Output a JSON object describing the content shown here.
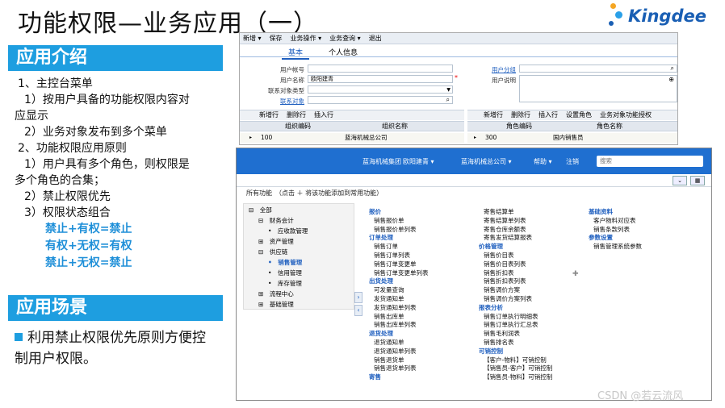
{
  "title": "功能权限—业务应用（一）",
  "logo_text": "Kingdee",
  "section1": "应用介绍",
  "section2": "应用场景",
  "left_lines": [
    "1、主控台菜单",
    "1）按用户具备的功能权限内容对",
    "应显示",
    "2）业务对象发布到多个菜单",
    "2、功能权限应用原则",
    "1）用户具有多个角色，则权限是",
    "多个角色的合集；",
    "2）禁止权限优先",
    "3）权限状态组合"
  ],
  "highlight_lines": [
    "禁止+有权=禁止",
    "有权+无权=有权",
    "禁止+无权=禁止"
  ],
  "bullet_text": "利用禁止权限优先原则方便控制用户权限。",
  "watermark": "CSDN @若云流风",
  "win1": {
    "toolbar": [
      "新增 ▾",
      "保存",
      "业务操作 ▾",
      "业务查询 ▾",
      "退出"
    ],
    "tabs": [
      "基本",
      "个人信息"
    ],
    "fields": {
      "account_label": "用户帐号",
      "name_label": "用户名称",
      "name_value": "欧阳建青",
      "objtype_label": "联系对象类型",
      "obj_label": "联系对象",
      "group_label": "用户分组",
      "desc_label": "用户说明"
    },
    "grid_left": {
      "actions": [
        "新增行",
        "删除行",
        "插入行"
      ],
      "headers": [
        "组织编码",
        "组织名称"
      ],
      "row": [
        "100",
        "蓝海机械总公司"
      ]
    },
    "grid_right": {
      "actions": [
        "新增行",
        "删除行",
        "插入行",
        "设置角色",
        "业务对象功能授权"
      ],
      "headers": [
        "角色编码",
        "角色名称"
      ],
      "row": [
        "300",
        "国内销售员"
      ]
    }
  },
  "win2": {
    "nav": [
      "蓝海机械集团",
      "欧阳建青 ▾",
      "蓝海机械总公司 ▾",
      "帮助 ▾",
      "注销"
    ],
    "search_placeholder": "搜索",
    "crumb": "所有功能　（点击 ＋ 将该功能添加到常用功能）",
    "tree": [
      {
        "t": "⊟　全部",
        "d": 0
      },
      {
        "t": "⊟　财务会计",
        "d": 1
      },
      {
        "t": "•　应收款管理",
        "d": 2
      },
      {
        "t": "⊞　资产管理",
        "d": 1
      },
      {
        "t": "⊟　供应链",
        "d": 1
      },
      {
        "t": "•　销售管理",
        "d": 2
      },
      {
        "t": "•　信用管理",
        "d": 2
      },
      {
        "t": "•　库存管理",
        "d": 2
      },
      {
        "t": "⊞　流程中心",
        "d": 1
      },
      {
        "t": "⊞　基础管理",
        "d": 1
      }
    ],
    "col1": [
      {
        "c": "报价"
      },
      {
        "m": "销售报价单"
      },
      {
        "m": "销售报价单列表"
      },
      {
        "c": "订单处理"
      },
      {
        "m": "销售订单"
      },
      {
        "m": "销售订单列表"
      },
      {
        "m": "销售订单变更单"
      },
      {
        "m": "销售订单变更单列表"
      },
      {
        "c": "出货处理"
      },
      {
        "m": "可发量查询"
      },
      {
        "m": "发货通知单"
      },
      {
        "m": "发货通知单列表"
      },
      {
        "m": "销售出库单"
      },
      {
        "m": "销售出库单列表"
      },
      {
        "c": "退货处理"
      },
      {
        "m": "退货通知单"
      },
      {
        "m": "退货通知单列表"
      },
      {
        "m": "销售退货单"
      },
      {
        "m": "销售退货单列表"
      },
      {
        "c": "寄售"
      }
    ],
    "col2": [
      {
        "m": "寄售结算单"
      },
      {
        "m": "寄售结算单列表"
      },
      {
        "m": "寄售仓库余额表"
      },
      {
        "m": "寄售发货结算报表"
      },
      {
        "c": "价格管理"
      },
      {
        "m": "销售价目表"
      },
      {
        "m": "销售价目表列表"
      },
      {
        "m": "销售折扣表"
      },
      {
        "m": "销售折扣表列表"
      },
      {
        "m": "销售调价方案"
      },
      {
        "m": "销售调价方案列表"
      },
      {
        "c": "报表分析"
      },
      {
        "m": "销售订单执行明细表"
      },
      {
        "m": "销售订单执行汇总表"
      },
      {
        "m": "销售毛利润表"
      },
      {
        "m": "销售排名表"
      },
      {
        "c": "可销控制"
      },
      {
        "m": "【客户-物料】可销控制"
      },
      {
        "m": "【销售员-客户】可销控制"
      },
      {
        "m": "【销售员-物料】可销控制"
      }
    ],
    "col3": [
      {
        "c": "基础资料"
      },
      {
        "m": "客户物料对应表"
      },
      {
        "m": "销售条款列表"
      },
      {
        "c": "参数设置"
      },
      {
        "m": "销售管理系统参数"
      }
    ]
  }
}
